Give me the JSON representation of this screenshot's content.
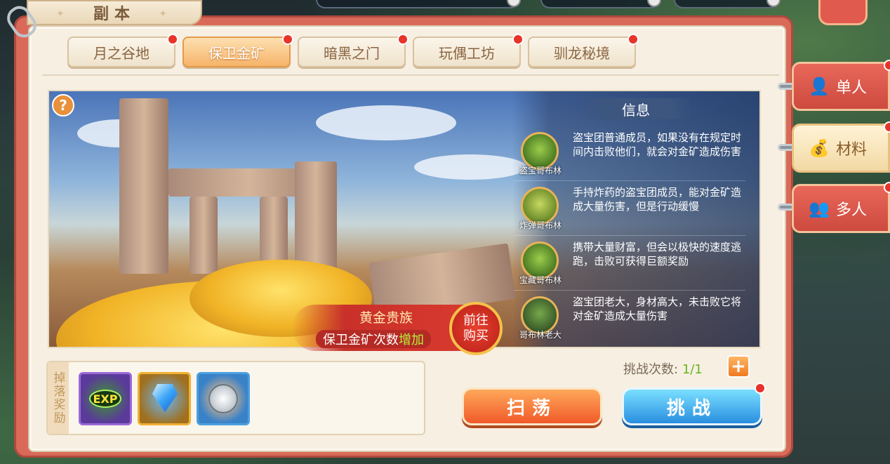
{
  "window": {
    "title": "副本"
  },
  "tabs": [
    {
      "label": "月之谷地",
      "active": false,
      "badge": true
    },
    {
      "label": "保卫金矿",
      "active": true,
      "badge": true
    },
    {
      "label": "暗黑之门",
      "active": false,
      "badge": true
    },
    {
      "label": "玩偶工坊",
      "active": false,
      "badge": true
    },
    {
      "label": "驯龙秘境",
      "active": false,
      "badge": true
    }
  ],
  "help_icon": "question-icon",
  "info": {
    "title": "信息",
    "enemies": [
      {
        "name": "盗宝哥布林",
        "desc": "盗宝团普通成员，如果没有在规定时间内击败他们，就会对金矿造成伤害"
      },
      {
        "name": "炸弹哥布林",
        "desc": "手持炸药的盗宝团成员，能对金矿造成大量伤害，但是行动缓慢"
      },
      {
        "name": "宝藏哥布林",
        "desc": "携带大量财富，但会以极快的速度逃跑，击败可获得巨额奖励"
      },
      {
        "name": "哥布林老大",
        "desc": "盗宝团老大，身材高大，未击败它将对金矿造成大量伤害"
      }
    ]
  },
  "promo": {
    "title": "黄金贵族",
    "line_prefix": "保卫金矿次数",
    "line_highlight": "增加",
    "go_label_1": "前往",
    "go_label_2": "购买"
  },
  "rewards": {
    "label": "掉落奖励",
    "items": [
      {
        "icon": "exp-icon",
        "text": "EXP"
      },
      {
        "icon": "diamond-icon"
      },
      {
        "icon": "silver-coin-icon"
      }
    ]
  },
  "challenge": {
    "label": "挑战次数:",
    "value": "1/1",
    "add_icon": "plus-icon"
  },
  "buttons": {
    "sweep": "扫荡",
    "fight": "挑战"
  },
  "side_tabs": [
    {
      "label": "单人",
      "icon": "person-icon",
      "active": false
    },
    {
      "label": "材料",
      "icon": "bag-icon",
      "active": true
    },
    {
      "label": "多人",
      "icon": "group-icon",
      "active": false
    }
  ],
  "colors": {
    "accent": "#f6b46a",
    "badge": "#e8332a",
    "highlight": "#b6f03a",
    "count": "#6ab41e"
  }
}
